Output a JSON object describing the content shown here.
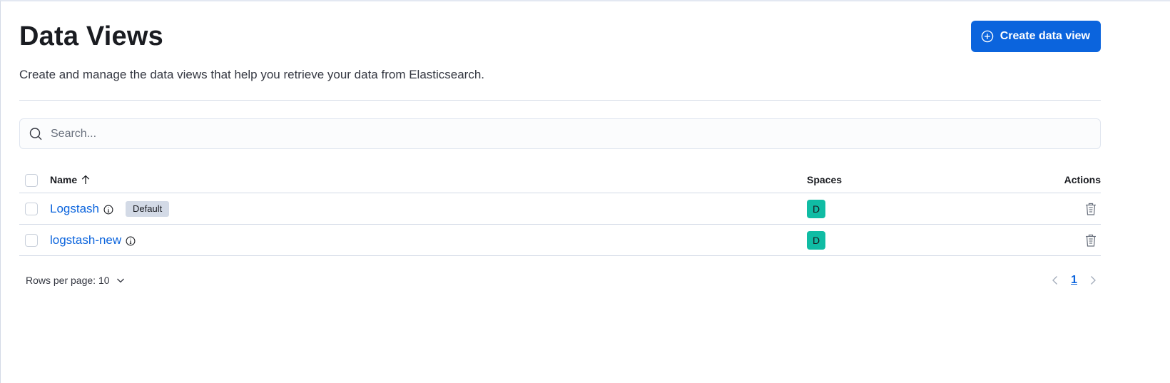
{
  "header": {
    "title": "Data Views",
    "create_button_label": "Create data view",
    "description": "Create and manage the data views that help you retrieve your data from Elasticsearch."
  },
  "search": {
    "placeholder": "Search...",
    "value": ""
  },
  "table": {
    "columns": {
      "name": "Name",
      "spaces": "Spaces",
      "actions": "Actions"
    },
    "sort": "ascending",
    "rows": [
      {
        "name": "Logstash",
        "badge": "Default",
        "space_initial": "D"
      },
      {
        "name": "logstash-new",
        "badge": "",
        "space_initial": "D"
      }
    ]
  },
  "footer": {
    "rows_per_page_label": "Rows per page: 10",
    "current_page": "1"
  },
  "colors": {
    "accent": "#0b64dd",
    "space_avatar": "#10bca4",
    "badge_bg": "#d3dae6",
    "border": "#d3dae6"
  },
  "icons": {
    "create_button": "plus-in-circle-icon",
    "search": "search-icon",
    "sort": "arrow-up-icon",
    "info": "info-icon",
    "delete": "trash-icon",
    "rows_per_page": "chevron-down-icon",
    "prev": "chevron-left-icon",
    "next": "chevron-right-icon"
  }
}
